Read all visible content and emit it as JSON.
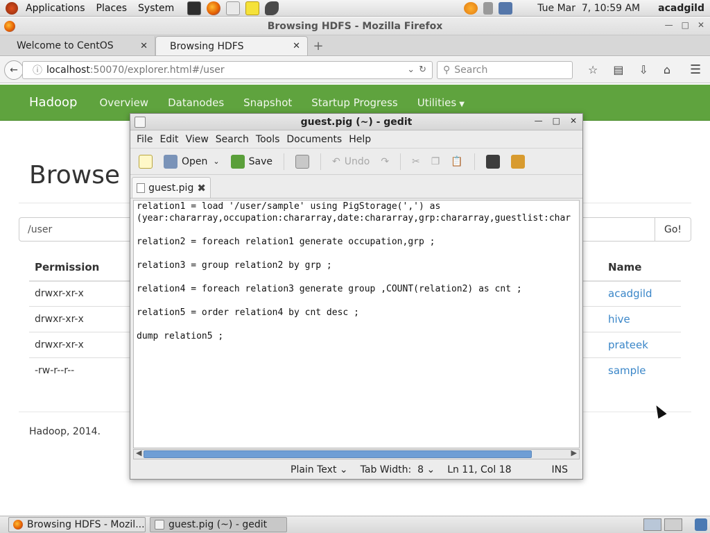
{
  "top_panel": {
    "menus": [
      "Applications",
      "Places",
      "System"
    ],
    "datetime": "Tue Mar  7, 10:59 AM",
    "user": "acadgild"
  },
  "firefox": {
    "window_title": "Browsing HDFS - Mozilla Firefox",
    "tabs": [
      {
        "label": "Welcome to CentOS"
      },
      {
        "label": "Browsing HDFS"
      }
    ],
    "url_host": "localhost",
    "url_rest": ":50070/explorer.html#/user",
    "search_placeholder": "Search"
  },
  "hadoop": {
    "brand": "Hadoop",
    "nav": [
      "Overview",
      "Datanodes",
      "Snapshot",
      "Startup Progress",
      "Utilities"
    ],
    "heading": "Browse D",
    "path_value": "/user",
    "go_label": "Go!",
    "columns": {
      "permission": "Permission",
      "name": "Name"
    },
    "rows": [
      {
        "permission": "drwxr-xr-x",
        "name": "acadgild"
      },
      {
        "permission": "drwxr-xr-x",
        "name": "hive"
      },
      {
        "permission": "drwxr-xr-x",
        "name": "prateek"
      },
      {
        "permission": "-rw-r--r--",
        "name": "sample"
      }
    ],
    "footer": "Hadoop, 2014."
  },
  "gedit": {
    "title": "guest.pig (~) - gedit",
    "menu": [
      "File",
      "Edit",
      "View",
      "Search",
      "Tools",
      "Documents",
      "Help"
    ],
    "toolbar": {
      "open": "Open",
      "save": "Save",
      "undo": "Undo"
    },
    "tab_label": "guest.pig",
    "lines": [
      "relation1 = load '/user/sample' using PigStorage(',') as",
      "(year:chararray,occupation:chararray,date:chararray,grp:chararray,guestlist:char",
      "",
      "relation2 = foreach relation1 generate occupation,grp ;",
      "",
      "relation3 = group relation2 by grp ;",
      "",
      "relation4 = foreach relation3 generate group ,COUNT(relation2) as cnt ;",
      "",
      "relation5 = order relation4 by cnt desc ;",
      "",
      "dump relation5 ;"
    ],
    "status": {
      "syntax": "Plain Text",
      "tab_width": "Tab Width:  8",
      "position": "Ln 11, Col 18",
      "mode": "INS"
    }
  },
  "taskbar": {
    "tasks": [
      {
        "label": "Browsing HDFS - Mozil..."
      },
      {
        "label": "guest.pig (~) - gedit"
      }
    ]
  },
  "colors": {
    "hadoop_green": "#5fa33e",
    "link_blue": "#3a86c8"
  }
}
